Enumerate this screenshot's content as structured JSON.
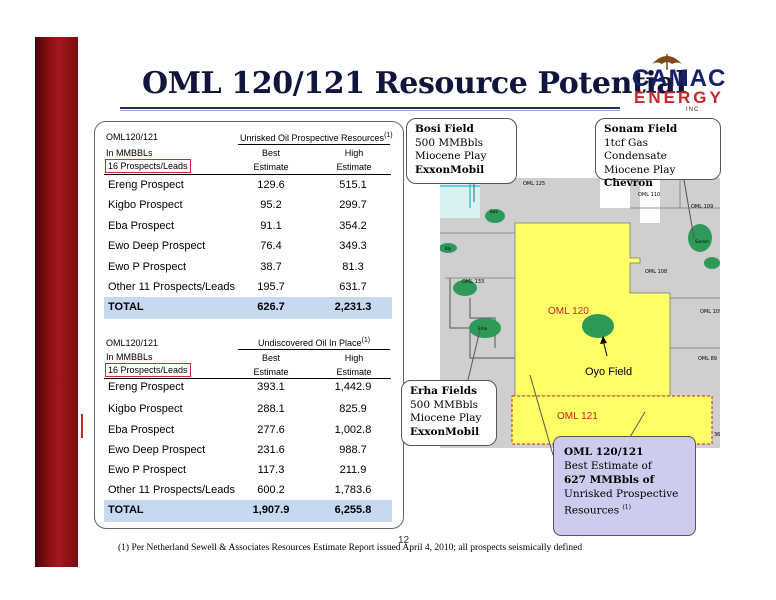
{
  "title": "OML 120/121 Resource Potential",
  "logo": {
    "line1": "CAMAC",
    "line2": "ENERGY",
    "line3": "INC."
  },
  "table1": {
    "label": "OML120/121",
    "header": "Unrisked Oil Prospective Resources",
    "header_sup": "(1)",
    "unit": "In MMBBLs",
    "count": "16 Prospects/Leads",
    "col1": [
      "Best",
      "Estimate"
    ],
    "col2": [
      "High",
      "Estimate"
    ],
    "rows": [
      {
        "name": "Ereng Prospect",
        "best": "129.6",
        "high": "515.1"
      },
      {
        "name": "Kigbo Prospect",
        "best": "95.2",
        "high": "299.7"
      },
      {
        "name": "Eba Prospect",
        "best": "91.1",
        "high": "354.2"
      },
      {
        "name": "Ewo Deep Prospect",
        "best": "76.4",
        "high": "349.3"
      },
      {
        "name": "Ewo P Prospect",
        "best": "38.7",
        "high": "81.3"
      },
      {
        "name": "Other 11 Prospects/Leads",
        "best": "195.7",
        "high": "631.7"
      }
    ],
    "total": {
      "name": "TOTAL",
      "best": "626.7",
      "high": "2,231.3"
    }
  },
  "table2": {
    "label": "OML120/121",
    "header": "Undiscovered Oil In Place",
    "header_sup": "(1)",
    "unit": "In MMBBLs",
    "count": "16 Prospects/Leads",
    "col1": [
      "Best",
      "Estimate"
    ],
    "col2": [
      "High",
      "Estimate"
    ],
    "rows": [
      {
        "name": "Ereng Prospect",
        "best": "393.1",
        "high": "1,442.9"
      },
      {
        "name": "Kigbo Prospect",
        "best": "288.1",
        "high": "825.9"
      },
      {
        "name": "Eba Prospect",
        "best": "277.6",
        "high": "1,002.8"
      },
      {
        "name": "Ewo Deep Prospect",
        "best": "231.6",
        "high": "988.7"
      },
      {
        "name": "Ewo P Prospect",
        "best": "117.3",
        "high": "211.9"
      },
      {
        "name": "Other  11 Prospects/Leads",
        "best": "600.2",
        "high": "1,783.6"
      }
    ],
    "total": {
      "name": "TOTAL",
      "best": "1,907.9",
      "high": "6,255.8"
    }
  },
  "page_number": "12",
  "footnote": "(1) Per Netherland Sewell & Associates Resources Estimate Report issued April 4, 2010; all prospects seismically defined",
  "callouts": {
    "bosi": {
      "title": "Bosi Field",
      "l1": "500 MMBbls",
      "l2": "Miocene Play",
      "op": "ExxonMobil"
    },
    "sonam": {
      "title": "Sonam Field",
      "l1": "1tcf Gas Condensate",
      "l2": "Miocene Play",
      "op": "Chevron"
    },
    "erha": {
      "title": "Erha Fields",
      "l1": "500 MMBbls",
      "l2": "Miocene Play",
      "op": "ExxonMobil"
    },
    "oml": {
      "l1": "OML 120/121",
      "l2": "Best Estimate of",
      "l3": "627 MMBbls of",
      "l4": "Unrisked Prospective",
      "l5": "Resources",
      "sup": "(1)"
    }
  },
  "map": {
    "labels": {
      "oml125": "OML 125",
      "oml110": "OML 110",
      "oml109": "OML 109",
      "oml109b": "OML 109",
      "oml108": "OML 108",
      "oml133": "OML 133",
      "oml89": "OML 89",
      "oml120": "OML 120",
      "oml121": "OML 121",
      "oyo": "Oyo Field",
      "bosi": "Bosi",
      "erha": "Erha",
      "sonam": "Sonam",
      "bly": "Bly",
      "ehra": "Erha",
      "c": "36"
    },
    "colors": {
      "block": "#ffff66",
      "field": "#2e9a5a",
      "grey": "#cfcfcf",
      "line": "#7a7a7a",
      "red": "#cc2020"
    }
  }
}
